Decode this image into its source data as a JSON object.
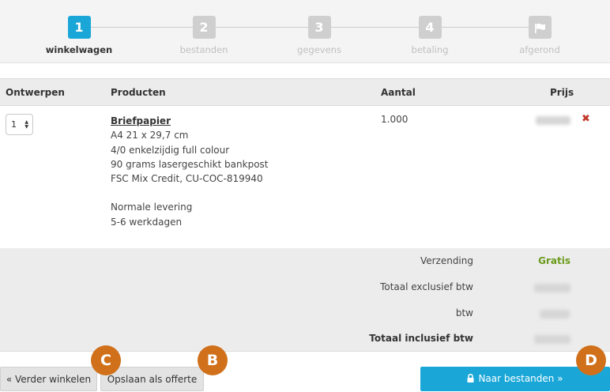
{
  "steps": [
    {
      "number": "1",
      "label": "winkelwagen",
      "active": true
    },
    {
      "number": "2",
      "label": "bestanden",
      "active": false
    },
    {
      "number": "3",
      "label": "gegevens",
      "active": false
    },
    {
      "number": "4",
      "label": "betaling",
      "active": false
    },
    {
      "number": "",
      "label": "afgerond",
      "active": false,
      "icon": "flag-icon"
    }
  ],
  "table": {
    "headers": {
      "designs": "Ontwerpen",
      "products": "Producten",
      "quantity": "Aantal",
      "price": "Prijs"
    },
    "row": {
      "designs_value": "1",
      "product_name": "Briefpapier",
      "specs": [
        "A4 21 x 29,7 cm",
        "4/0 enkelzijdig full colour",
        "90 grams lasergeschikt bankpost",
        "FSC Mix Credit, CU-COC-819940"
      ],
      "delivery": [
        "Normale levering",
        "5-6 werkdagen"
      ],
      "quantity": "1.000",
      "remove_icon": "close-icon"
    }
  },
  "totals": {
    "shipping_label": "Verzending",
    "shipping_value": "Gratis",
    "excl_label": "Totaal exclusief btw",
    "vat_label": "btw",
    "incl_label": "Totaal inclusief btw"
  },
  "buttons": {
    "continue_shopping": "« Verder winkelen",
    "save_quote": "Opslaan als offerte",
    "next": "Naar bestanden »"
  },
  "markers": {
    "c": "C",
    "b": "B",
    "d": "D"
  },
  "colors": {
    "accent": "#1aa7d8",
    "marker": "#d0701a",
    "free": "#6a9a1a",
    "remove": "#c0392b"
  }
}
